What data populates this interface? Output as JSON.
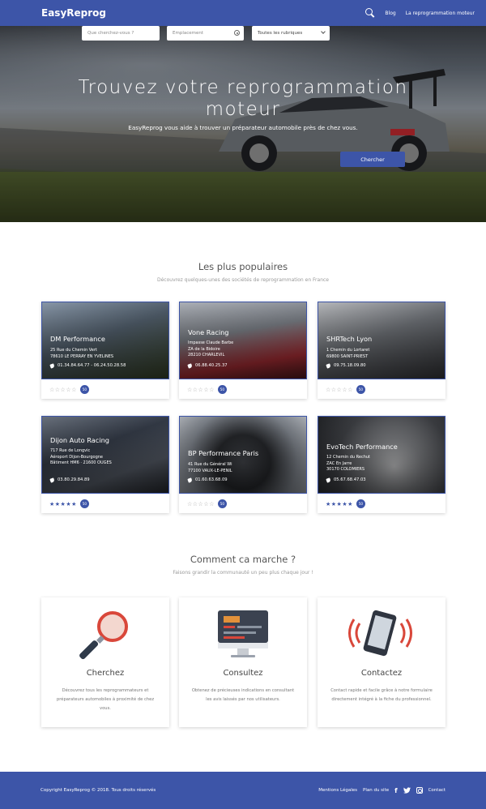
{
  "nav": {
    "brand": "EasyReprog",
    "links": [
      "Blog",
      "La reprogrammation moteur"
    ],
    "search_icon": "search-icon"
  },
  "hero": {
    "title_line1": "Trouvez votre reprogrammation",
    "title_line2": "moteur",
    "subtitle": "EasyReprog vous aide à trouver un préparateur automobile près de chez vous.",
    "search_placeholder": "Que cherchez-vous ?",
    "location_placeholder": "Emplacement",
    "category_selected": "Toutes les rubriques",
    "search_button": "Chercher"
  },
  "popular": {
    "title": "Les plus populaires",
    "subtitle": "Découvrez quelques-unes des sociétés de reprogrammation en France",
    "cards": [
      {
        "name": "DM Performance",
        "addr1": "25 Rue du Chemin Vert",
        "addr2": "78610 LE PERRAY EN YVELINES",
        "addr3": "",
        "phone": "01.34.84.64.77 - 06.24.50.28.58",
        "stars": "☆☆☆☆☆",
        "rating": 0,
        "badge": "50"
      },
      {
        "name": "Vone Racing",
        "addr1": "Impasse Claude Barbe",
        "addr2": "ZA de la Bidoire",
        "addr3": "28210 CHARLEVIL",
        "phone": "06.88.40.25.37",
        "stars": "☆☆☆☆☆",
        "rating": 0,
        "badge": "50"
      },
      {
        "name": "SHRTech Lyon",
        "addr1": "1 Chemin du Lortaret",
        "addr2": "69800 SAINT-PRIEST",
        "addr3": "",
        "phone": "09.75.18.09.80",
        "stars": "☆☆☆☆☆",
        "rating": 0,
        "badge": "50"
      },
      {
        "name": "Dijon Auto Racing",
        "addr1": "717 Rue de Longvic",
        "addr2": "Aéroport Dijon-Bourgogne",
        "addr3": "Bâtiment HM6 · 21600 OUGES",
        "phone": "03.80.29.84.89",
        "stars": "★★★★★",
        "rating": 5,
        "badge": "50"
      },
      {
        "name": "BP Performance Paris",
        "addr1": "41 Rue du Général Wi",
        "addr2": "77100 VAUX-LE-PENIL",
        "addr3": "",
        "phone": "01.60.63.68.09",
        "stars": "☆☆☆☆☆",
        "rating": 0,
        "badge": "50"
      },
      {
        "name": "EvoTech Performance",
        "addr1": "12 Chemin du Rechut",
        "addr2": "ZAC En Jarre",
        "addr3": "30170 COLOMIERS",
        "phone": "05.67.68.47.03",
        "stars": "★★★★★",
        "rating": 5,
        "badge": "50"
      }
    ]
  },
  "how": {
    "title": "Comment ca marche ?",
    "subtitle": "Faisons grandir la communauté un peu plus chaque jour !",
    "items": [
      {
        "title": "Cherchez",
        "text": "Découvrez tous les reprogrammateurs et préparateurs automobiles à proximité de chez vous.",
        "icon": "magnifier-icon"
      },
      {
        "title": "Consultez",
        "text": "Obtenez de précieuses indications en consultant les avis laissés par nos utilisateurs.",
        "icon": "monitor-icon"
      },
      {
        "title": "Contactez",
        "text": "Contact rapide et facile grâce à notre formulaire directement intégré à la fiche du professionnel.",
        "icon": "phone-ringing-icon"
      }
    ]
  },
  "footer": {
    "copyright": "Copyright EasyReprog © 2018. Tous droits réservés",
    "legal": "Mentions Légales",
    "sitemap": "Plan du site",
    "contact": "Contact",
    "social": [
      "facebook-icon",
      "twitter-icon",
      "instagram-icon"
    ]
  },
  "colors": {
    "primary": "#3d55a8",
    "accent_red": "#d9473a"
  }
}
